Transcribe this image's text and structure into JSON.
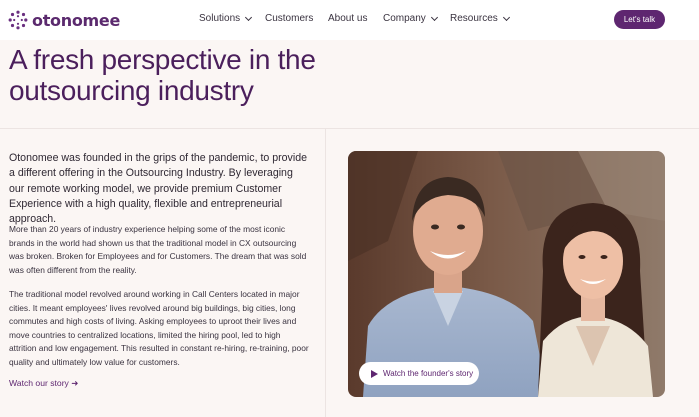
{
  "brand": {
    "name": "otonomee",
    "accent": "#5e2670"
  },
  "nav": {
    "items": [
      {
        "label": "Solutions",
        "dropdown": true
      },
      {
        "label": "Customers",
        "dropdown": false
      },
      {
        "label": "About us",
        "dropdown": false
      },
      {
        "label": "Company",
        "dropdown": true
      },
      {
        "label": "Resources",
        "dropdown": true
      }
    ],
    "cta": "Let's talk"
  },
  "hero": {
    "title": "A fresh perspective in the outsourcing industry"
  },
  "content": {
    "lead": "Otonomee was founded in the grips of the pandemic, to provide a different offering in the Outsourcing Industry. By leveraging our remote working model, we provide premium Customer Experience with a high quality, flexible and entrepreneurial approach.",
    "paragraph1": "More than 20 years of industry experience helping some of the most iconic brands in the world had shown us that the traditional model in CX outsourcing was broken. Broken for Employees and for Customers. The dream that was sold was often different from the reality.",
    "paragraph2": "The traditional model revolved around working in Call Centers located in major cities. It meant employees' lives revolved around big buildings, big cities, long commutes and high costs of living. Asking employees to uproot their lives and move countries to centralized locations, limited the hiring pool, led to high attrition and low engagement. This resulted in constant re-hiring, re-training, poor quality and ultimately low value for customers.",
    "story_link": "Watch our story ➜"
  },
  "media": {
    "video_button": "Watch the founder's story",
    "play_icon": "play-icon"
  }
}
